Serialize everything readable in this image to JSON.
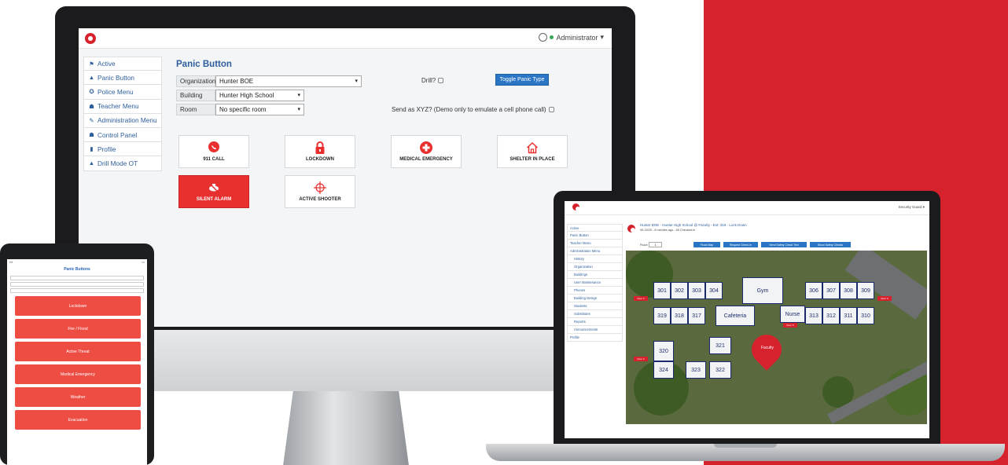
{
  "imac": {
    "user_menu": "Administrator",
    "sidebar": [
      {
        "label": "Active",
        "icon": "flag-icon",
        "glyph": "⚑"
      },
      {
        "label": "Panic Button",
        "icon": "warning-icon",
        "glyph": "▲"
      },
      {
        "label": "Police Menu",
        "icon": "police-icon",
        "glyph": "✪"
      },
      {
        "label": "Teacher Menu",
        "icon": "teacher-icon",
        "glyph": "☗"
      },
      {
        "label": "Administration Menu",
        "icon": "wrench-icon",
        "glyph": "✎"
      },
      {
        "label": "Control Panel",
        "icon": "control-panel-icon",
        "glyph": "☗"
      },
      {
        "label": "Profile",
        "icon": "profile-icon",
        "glyph": "▮"
      },
      {
        "label": "Drill Mode OT",
        "icon": "warning-icon",
        "glyph": "▲"
      }
    ],
    "title": "Panic Button",
    "form": {
      "organization_label": "Organization",
      "organization_value": "Hunter BOE",
      "building_label": "Building",
      "building_value": "Hunter High School",
      "room_label": "Room",
      "room_value": "No specific room"
    },
    "drill_label": "Drill?",
    "toggle_button": "Toggle Panic Type",
    "send_as": "Send as XYZ? (Demo only to emulate a cell phone call)",
    "tiles": [
      {
        "label": "911 CALL",
        "icon": "phone-call-icon"
      },
      {
        "label": "LOCKDOWN",
        "icon": "lock-icon"
      },
      {
        "label": "MEDICAL EMERGENCY",
        "icon": "medical-cross-icon"
      },
      {
        "label": "SHELTER IN PLACE",
        "icon": "house-icon"
      },
      {
        "label": "SILENT ALARM",
        "icon": "silent-alarm-icon"
      },
      {
        "label": "ACTIVE SHOOTER",
        "icon": "crosshair-icon"
      }
    ]
  },
  "tablet": {
    "title": "Panic Buttons",
    "buttons": [
      "Lockdown",
      "Fire / Flood",
      "Active Threat",
      "Medical Emergency",
      "Weather",
      "Evacuation"
    ]
  },
  "laptop": {
    "user_menu": "Security Guard",
    "header": "Hunter BOE - Hunter High School @ Faculty - Ext: 318 - Lock Down",
    "subheader": "05-15/20 - 8 minutes ago - 65 Checked-In",
    "floor_label": "Floor:",
    "floor_value": "1",
    "buttons": [
      "Flood Map",
      "Request Check-In",
      "Send Safety Check Text",
      "Show Safety Checks"
    ],
    "sidebar": [
      "Active",
      "Panic Button",
      "Teacher Menu",
      "Administration Menu",
      "History",
      "Organization",
      "Buildings",
      "User Maintenance",
      "Phones",
      "Building Design",
      "Students",
      "Substitutes",
      "Reports",
      "Announcements",
      "Profile"
    ],
    "rooms": [
      "301",
      "302",
      "303",
      "304",
      "Gym",
      "306",
      "307",
      "308",
      "309",
      "319",
      "318",
      "317",
      "Cafeteria",
      "Nurse",
      "313",
      "312",
      "311",
      "310",
      "320",
      "321",
      "324",
      "323",
      "322"
    ],
    "door_labels": [
      "Door 3",
      "Door 3",
      "Door 4",
      "Door 5"
    ],
    "marker": "Faculty"
  },
  "colors": {
    "brand_red": "#d6222c",
    "link_blue": "#2e5f9c",
    "button_blue": "#2a76c4",
    "tablet_red": "#ee4d44"
  }
}
